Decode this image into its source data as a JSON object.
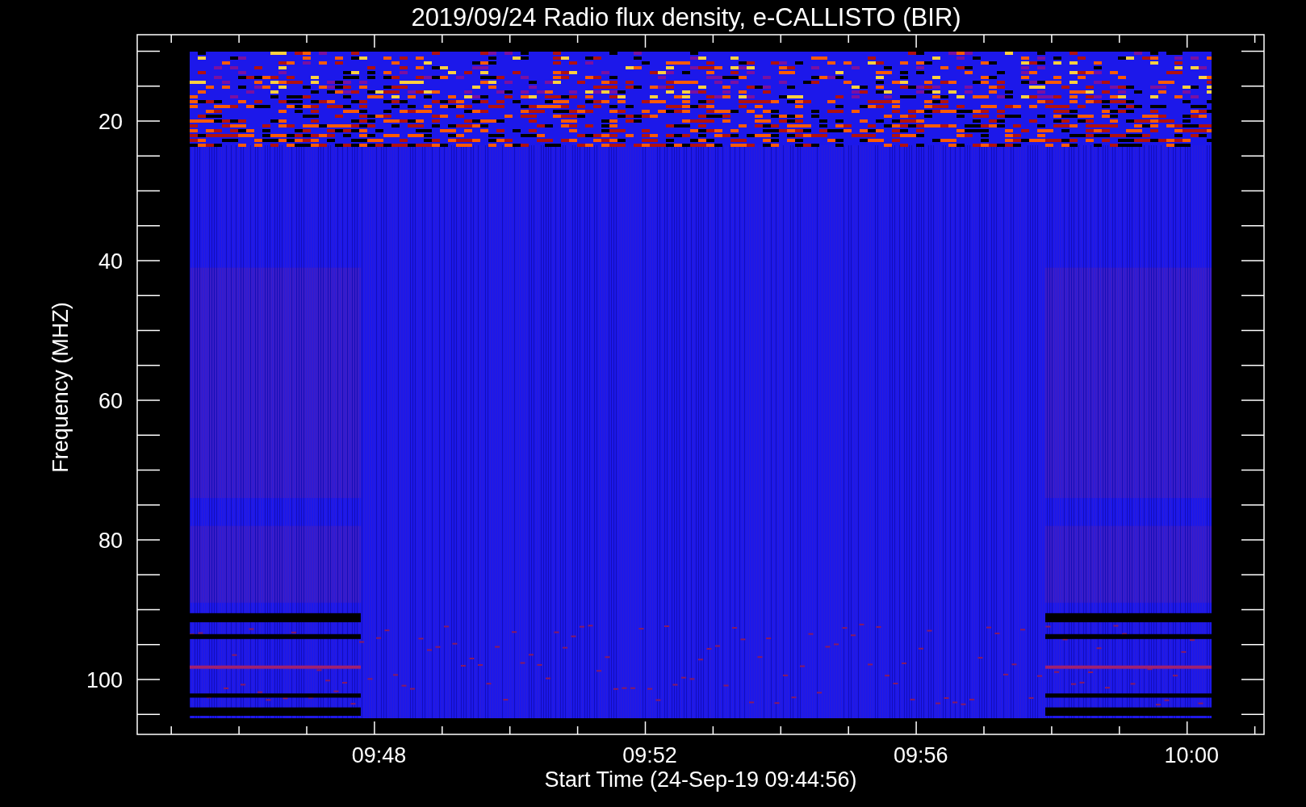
{
  "title": "2019/09/24  Radio flux density, e-CALLISTO (BIR)",
  "y_axis": {
    "label": "Frequency (MHZ)",
    "ticks": [
      "20",
      "40",
      "60",
      "80",
      "100"
    ]
  },
  "x_axis": {
    "label": "Start Time (24-Sep-19 09:44:56)",
    "ticks": [
      "09:48",
      "09:52",
      "09:56",
      "10:00"
    ]
  }
}
